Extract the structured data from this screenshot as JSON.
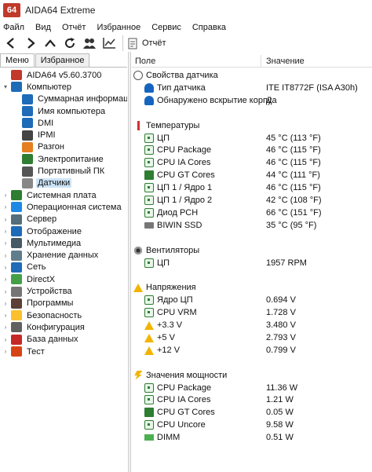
{
  "window": {
    "logo": "64",
    "title": "AIDA64 Extreme"
  },
  "menu": [
    "Файл",
    "Вид",
    "Отчёт",
    "Избранное",
    "Сервис",
    "Справка"
  ],
  "toolbar": {
    "buttons": [
      "back-icon",
      "forward-icon",
      "up-icon",
      "refresh-icon",
      "users-icon",
      "chart-icon"
    ],
    "report_label": "Отчёт"
  },
  "tabs": [
    "Меню",
    "Избранное"
  ],
  "tree": [
    {
      "label": "AIDA64 v5.60.3700",
      "level": 0,
      "expander": "",
      "icon": "aida-logo-icon",
      "color": "#c0392b"
    },
    {
      "label": "Компьютер",
      "level": 0,
      "expander": "▾",
      "icon": "computer-icon",
      "color": "#1e6bb8"
    },
    {
      "label": "Суммарная информация",
      "level": 1,
      "expander": "",
      "icon": "summary-icon",
      "color": "#1e6bb8"
    },
    {
      "label": "Имя компьютера",
      "level": 1,
      "expander": "",
      "icon": "computer-name-icon",
      "color": "#1e6bb8"
    },
    {
      "label": "DMI",
      "level": 1,
      "expander": "",
      "icon": "dmi-icon",
      "color": "#1e6bb8"
    },
    {
      "label": "IPMI",
      "level": 1,
      "expander": "",
      "icon": "ipmi-icon",
      "color": "#444444"
    },
    {
      "label": "Разгон",
      "level": 1,
      "expander": "",
      "icon": "overclock-icon",
      "color": "#e67e22"
    },
    {
      "label": "Электропитание",
      "level": 1,
      "expander": "",
      "icon": "power-icon",
      "color": "#2e7d32"
    },
    {
      "label": "Портативный ПК",
      "level": 1,
      "expander": "",
      "icon": "laptop-icon",
      "color": "#555555"
    },
    {
      "label": "Датчики",
      "level": 1,
      "expander": "",
      "icon": "sensor-icon",
      "color": "#888888",
      "selected": true
    },
    {
      "label": "Системная плата",
      "level": 0,
      "expander": "›",
      "icon": "motherboard-icon",
      "color": "#2e7d32"
    },
    {
      "label": "Операционная система",
      "level": 0,
      "expander": "›",
      "icon": "windows-icon",
      "color": "#1e88e5"
    },
    {
      "label": "Сервер",
      "level": 0,
      "expander": "›",
      "icon": "server-icon",
      "color": "#546e7a"
    },
    {
      "label": "Отображение",
      "level": 0,
      "expander": "›",
      "icon": "display-icon",
      "color": "#1e6bb8"
    },
    {
      "label": "Мультимедиа",
      "level": 0,
      "expander": "›",
      "icon": "multimedia-icon",
      "color": "#455a64"
    },
    {
      "label": "Хранение данных",
      "level": 0,
      "expander": "›",
      "icon": "storage-icon",
      "color": "#607d8b"
    },
    {
      "label": "Сеть",
      "level": 0,
      "expander": "›",
      "icon": "network-icon",
      "color": "#1e6bb8"
    },
    {
      "label": "DirectX",
      "level": 0,
      "expander": "›",
      "icon": "directx-icon",
      "color": "#43a047"
    },
    {
      "label": "Устройства",
      "level": 0,
      "expander": "›",
      "icon": "devices-icon",
      "color": "#757575"
    },
    {
      "label": "Программы",
      "level": 0,
      "expander": "›",
      "icon": "programs-icon",
      "color": "#5d4037"
    },
    {
      "label": "Безопасность",
      "level": 0,
      "expander": "›",
      "icon": "security-icon",
      "color": "#fbc02d"
    },
    {
      "label": "Конфигурация",
      "level": 0,
      "expander": "›",
      "icon": "config-icon",
      "color": "#616161"
    },
    {
      "label": "База данных",
      "level": 0,
      "expander": "›",
      "icon": "database-icon",
      "color": "#c62828"
    },
    {
      "label": "Тест",
      "level": 0,
      "expander": "›",
      "icon": "test-icon",
      "color": "#d84315"
    }
  ],
  "columns": {
    "field": "Поле",
    "value": "Значение"
  },
  "rows": [
    {
      "kind": "group",
      "label": "Свойства датчика",
      "value": "",
      "icon": "sensor-icon",
      "slot": 0
    },
    {
      "kind": "item",
      "label": "Тип датчика",
      "value": "ITE IT8772F  (ISA A30h)",
      "icon": "sensor-type-icon",
      "slot": 1
    },
    {
      "kind": "item",
      "label": "Обнаружено вскрытие корпуса",
      "value": "Да",
      "icon": "intrusion-icon",
      "slot": 2
    },
    {
      "kind": "group",
      "label": "Температуры",
      "value": "",
      "icon": "thermometer-icon",
      "slot": 4
    },
    {
      "kind": "item",
      "label": "ЦП",
      "value": "45 °C  (113 °F)",
      "icon": "cpu-icon",
      "slot": 5
    },
    {
      "kind": "item",
      "label": "CPU Package",
      "value": "46 °C  (115 °F)",
      "icon": "cpu-icon",
      "slot": 6
    },
    {
      "kind": "item",
      "label": "CPU IA Cores",
      "value": "46 °C  (115 °F)",
      "icon": "cpu-icon",
      "slot": 7
    },
    {
      "kind": "item",
      "label": "CPU GT Cores",
      "value": "44 °C  (111 °F)",
      "icon": "gpu-icon",
      "slot": 8
    },
    {
      "kind": "item",
      "label": "ЦП 1 / Ядро 1",
      "value": "46 °C  (115 °F)",
      "icon": "cpu-icon",
      "slot": 9
    },
    {
      "kind": "item",
      "label": "ЦП 1 / Ядро 2",
      "value": "42 °C  (108 °F)",
      "icon": "cpu-icon",
      "slot": 10
    },
    {
      "kind": "item",
      "label": "Диод PCH",
      "value": "66 °C  (151 °F)",
      "icon": "chipset-icon",
      "slot": 11
    },
    {
      "kind": "item",
      "label": "BIWIN SSD",
      "value": "35 °C  (95 °F)",
      "icon": "drive-icon",
      "slot": 12
    },
    {
      "kind": "group",
      "label": "Вентиляторы",
      "value": "",
      "icon": "fan-icon",
      "slot": 14
    },
    {
      "kind": "item",
      "label": "ЦП",
      "value": "1957 RPM",
      "icon": "cpu-icon",
      "slot": 15
    },
    {
      "kind": "group",
      "label": "Напряжения",
      "value": "",
      "icon": "voltage-icon",
      "slot": 17
    },
    {
      "kind": "item",
      "label": "Ядро ЦП",
      "value": "0.694 V",
      "icon": "cpu-icon",
      "slot": 18
    },
    {
      "kind": "item",
      "label": "CPU VRM",
      "value": "1.728 V",
      "icon": "cpu-icon",
      "slot": 19
    },
    {
      "kind": "item",
      "label": "+3.3 V",
      "value": "3.480 V",
      "icon": "warning-icon",
      "slot": 20
    },
    {
      "kind": "item",
      "label": "+5 V",
      "value": "2.793 V",
      "icon": "warning-icon",
      "slot": 21
    },
    {
      "kind": "item",
      "label": "+12 V",
      "value": "0.799 V",
      "icon": "warning-icon",
      "slot": 22
    },
    {
      "kind": "group",
      "label": "Значения мощности",
      "value": "",
      "icon": "power-values-icon",
      "slot": 24
    },
    {
      "kind": "item",
      "label": "CPU Package",
      "value": "11.36 W",
      "icon": "cpu-icon",
      "slot": 25
    },
    {
      "kind": "item",
      "label": "CPU IA Cores",
      "value": "1.21 W",
      "icon": "cpu-icon",
      "slot": 26
    },
    {
      "kind": "item",
      "label": "CPU GT Cores",
      "value": "0.05 W",
      "icon": "gpu-icon",
      "slot": 27
    },
    {
      "kind": "item",
      "label": "CPU Uncore",
      "value": "9.58 W",
      "icon": "cpu-icon",
      "slot": 28
    },
    {
      "kind": "item",
      "label": "DIMM",
      "value": "0.51 W",
      "icon": "memory-icon",
      "slot": 29
    }
  ]
}
